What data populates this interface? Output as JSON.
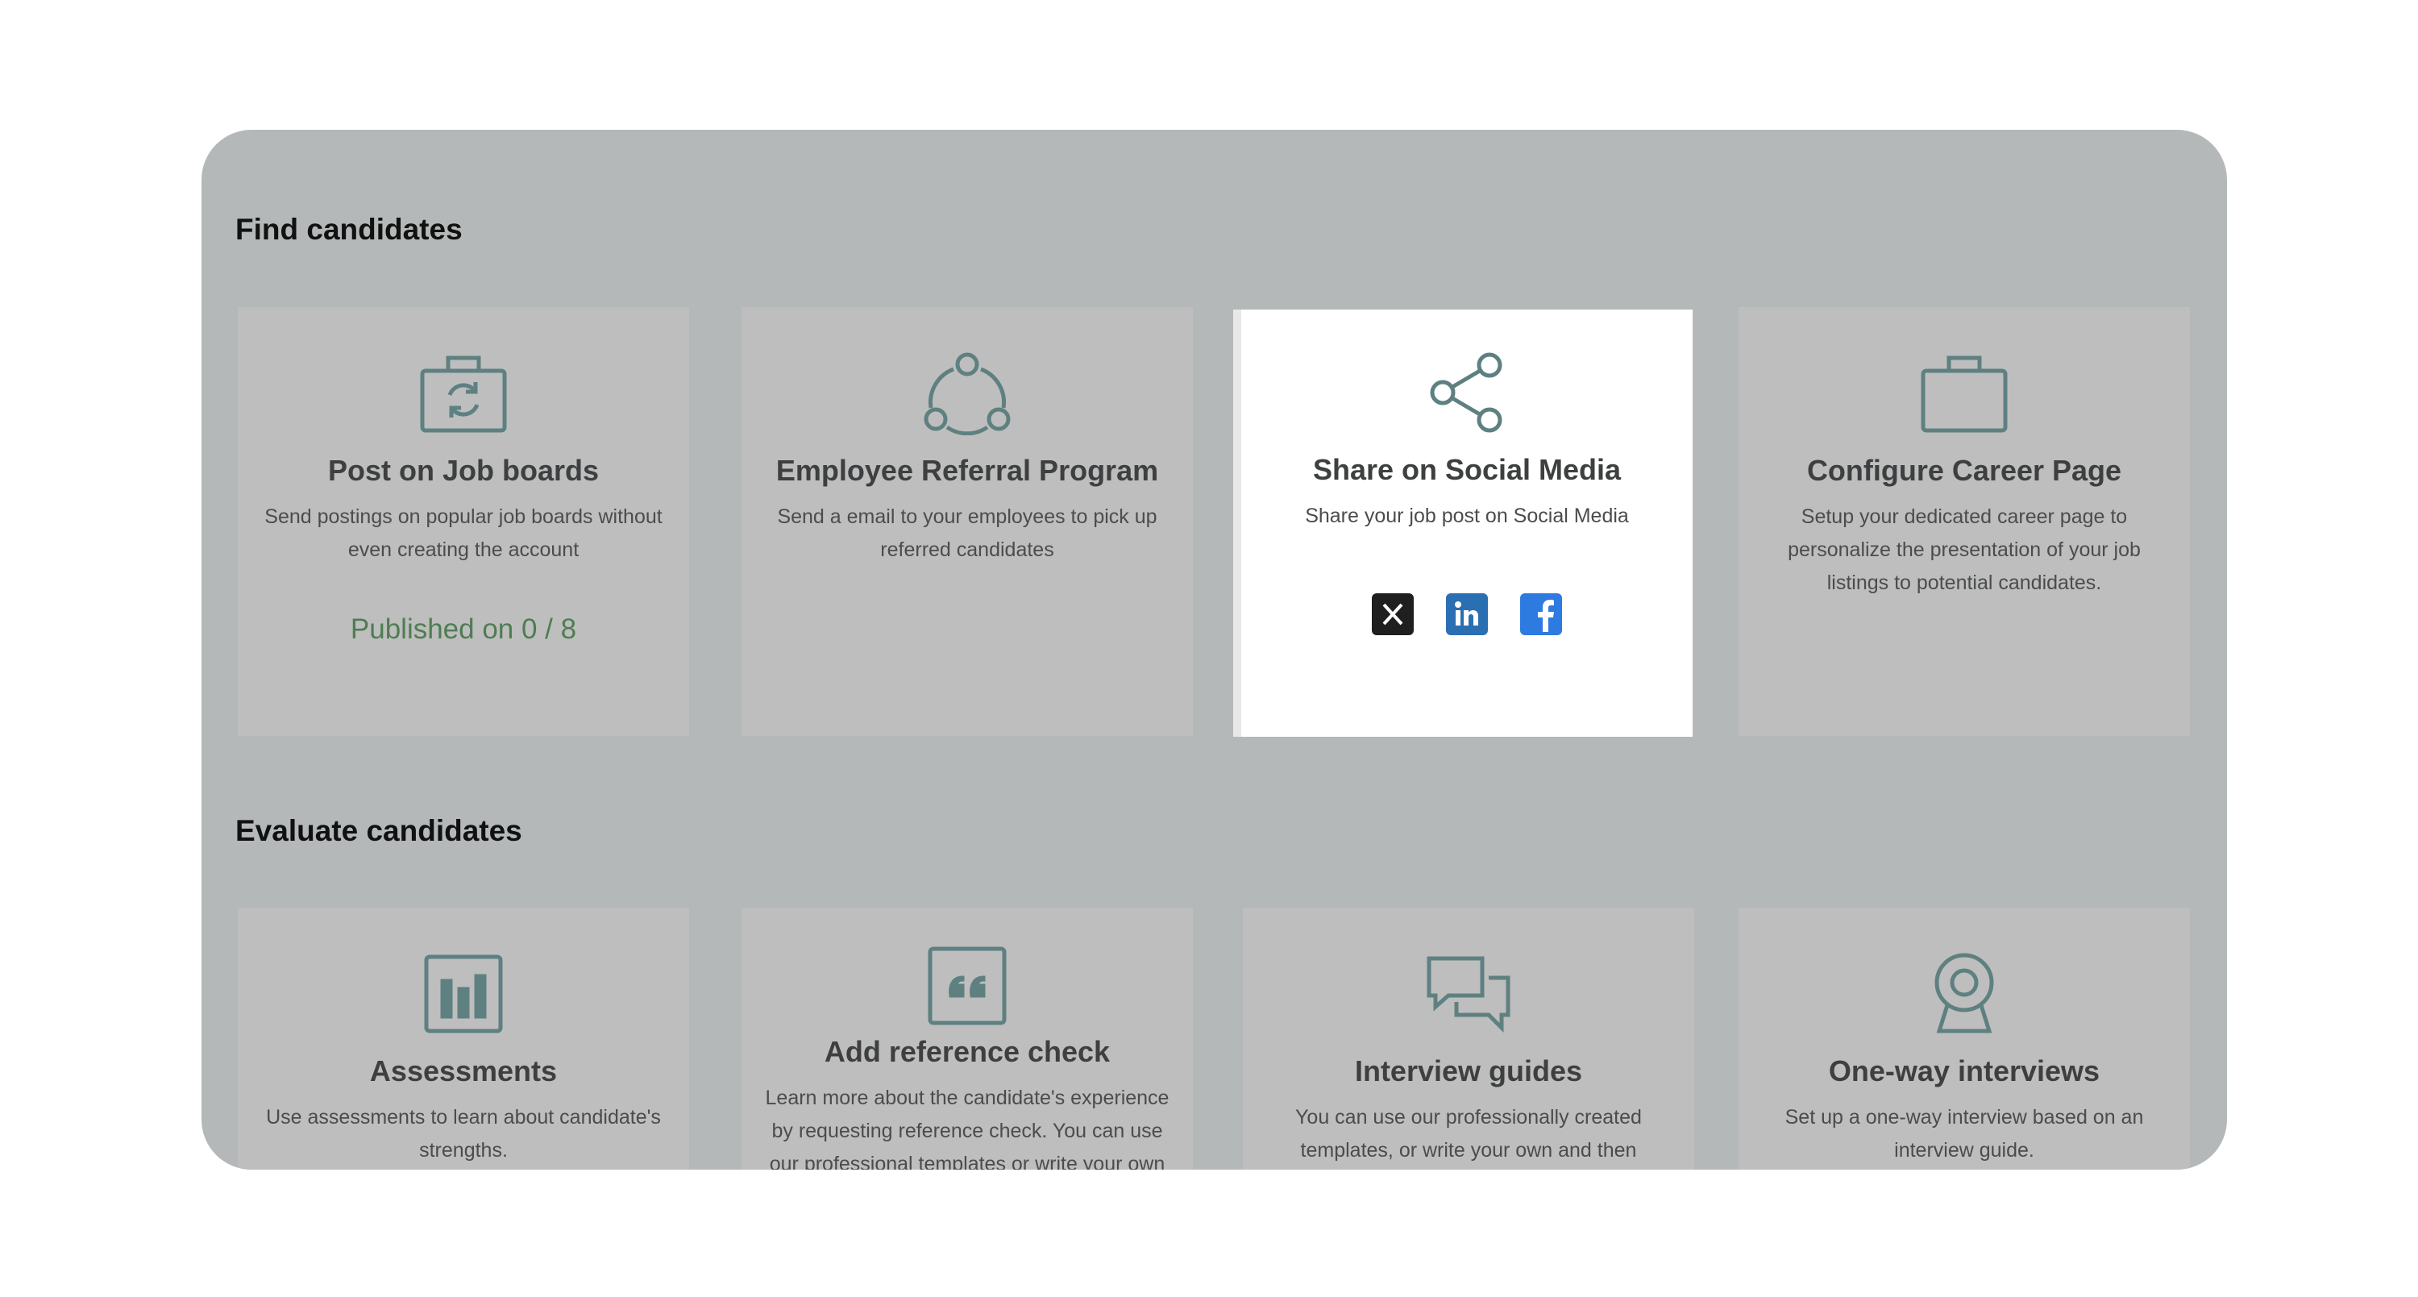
{
  "sections": [
    {
      "title": "Find candidates",
      "cards": [
        {
          "title": "Post on Job boards",
          "desc": "Send postings on popular job boards without even creating the account",
          "status": "Published on 0 / 8",
          "icon": "briefcase-refresh-icon"
        },
        {
          "title": "Employee Referral Program",
          "desc": "Send a email to your employees to pick up referred candidates",
          "icon": "referral-network-icon"
        },
        {
          "title": "Share on Social Media",
          "desc": "Share your job post on Social Media",
          "icon": "share-icon",
          "social": [
            "x-icon",
            "linkedin-icon",
            "facebook-icon"
          ]
        },
        {
          "title": "Configure Career Page",
          "desc": "Setup your dedicated career page to personalize the presentation of your job listings to potential candidates.",
          "icon": "briefcase-icon"
        }
      ]
    },
    {
      "title": "Evaluate candidates",
      "cards": [
        {
          "title": "Assessments",
          "desc": "Use assessments to learn about candidate's strengths.",
          "icon": "bar-chart-icon"
        },
        {
          "title": "Add reference check",
          "desc": "Learn more about the candidate's experience by requesting reference check. You can use our professional templates or write your own",
          "icon": "quote-icon"
        },
        {
          "title": "Interview guides",
          "desc": "You can use our professionally created templates, or write your own and then",
          "icon": "chat-bubbles-icon"
        },
        {
          "title": "One-way interviews",
          "desc": "Set up a one-way interview based on an interview guide.",
          "icon": "webcam-icon"
        }
      ]
    }
  ],
  "colors": {
    "panel": "#b4b8b8",
    "card": "#bebebe",
    "icon": "#5f8080",
    "published": "#4e7d52"
  }
}
